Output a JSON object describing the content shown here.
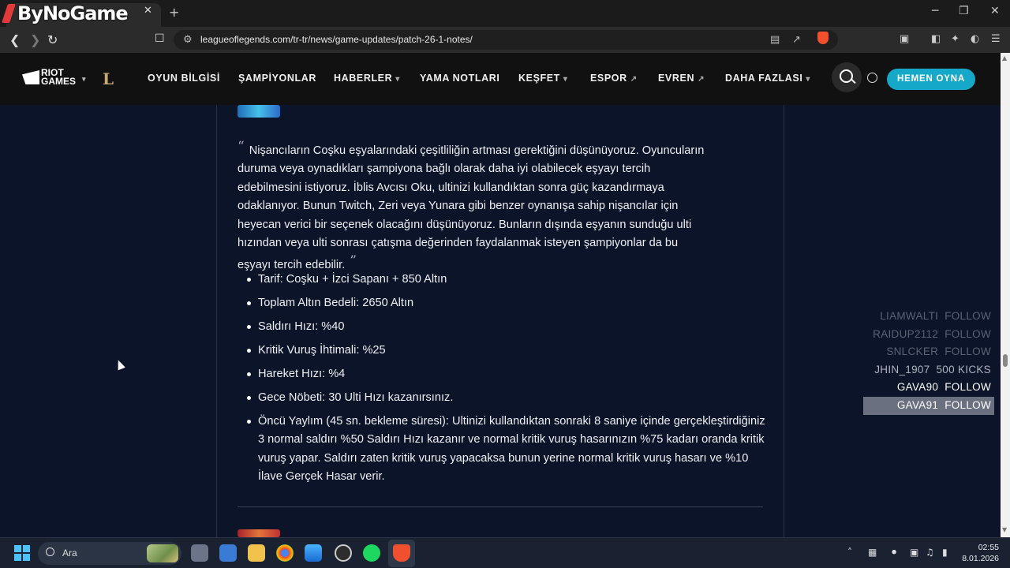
{
  "browser": {
    "tab_overlay_brand": "ByNoGame",
    "tab_close": "✕",
    "new_tab": "+",
    "url": "leagueoflegends.com/tr-tr/news/game-updates/patch-26-1-notes/",
    "window_controls": [
      "─",
      "❐",
      "✕"
    ]
  },
  "site_nav": {
    "riot_logo": "RIOT GAMES",
    "lol_logo": "L",
    "items": [
      {
        "label": "OYUN BİLGİSİ",
        "suffix": ""
      },
      {
        "label": "ŞAMPİYONLAR",
        "suffix": ""
      },
      {
        "label": "HABERLER",
        "suffix": "▾"
      },
      {
        "label": "YAMA NOTLARI",
        "suffix": ""
      },
      {
        "label": "KEŞFET",
        "suffix": "▾"
      },
      {
        "label": "ESPOR",
        "suffix": "↗"
      },
      {
        "label": "EVREN",
        "suffix": "↗"
      },
      {
        "label": "DAHA FAZLASI",
        "suffix": "▾"
      }
    ],
    "play_button": "HEMEN OYNA"
  },
  "article": {
    "quote_open": "“",
    "quote": "Nişancıların Coşku eşyalarındaki çeşitliliğin artması gerektiğini düşünüyoruz. Oyuncuların duruma veya oynadıkları şampiyona bağlı olarak daha iyi olabilecek eşyayı tercih edebilmesini istiyoruz. İblis Avcısı Oku, ultinizi kullandıktan sonra güç kazandırmaya odaklanıyor. Bunun Twitch, Zeri veya Yunara gibi benzer oynanışa sahip nişancılar için heyecan verici bir seçenek olacağını düşünüyoruz. Bunların dışında eşyanın sunduğu ulti hızından veya ulti sonrası çatışma değerinden faydalanmak isteyen şampiyonlar da bu eşyayı tercih edebilir.",
    "quote_close": "”",
    "bullets": [
      "Tarif: Coşku + İzci Sapanı + 850 Altın",
      "Toplam Altın Bedeli: 2650 Altın",
      "Saldırı Hızı: %40",
      "Kritik Vuruş İhtimali: %25",
      "Hareket Hızı: %4",
      "Gece Nöbeti: 30 Ulti Hızı kazanırsınız.",
      "Öncü Yaylım (45 sn. bekleme süresi): Ultinizi kullandıktan sonraki 8 saniye içinde gerçekleştirdiğiniz 3 normal saldırı %50 Saldırı Hızı kazanır ve normal kritik vuruş hasarınızın %75 kadarı oranda kritik vuruş yapar. Saldırı zaten kritik vuruş yapacaksa bunun yerine normal kritik vuruş hasarı ve %10 İlave Gerçek Hasar verir."
    ]
  },
  "chat_overlay": [
    {
      "user": "LIAMWALTI",
      "action": "FOLLOW",
      "style": "dim"
    },
    {
      "user": "RAIDUP2112",
      "action": "FOLLOW",
      "style": "dim"
    },
    {
      "user": "SNLCKER",
      "action": "FOLLOW",
      "style": "dim"
    },
    {
      "user": "JHIN_1907",
      "action": "500 KICKS",
      "style": "mid"
    },
    {
      "user": "GAVA90",
      "action": "FOLLOW",
      "style": "bright"
    },
    {
      "user": "GAVA91",
      "action": "FOLLOW",
      "style": "hl"
    }
  ],
  "taskbar": {
    "search_placeholder": "Ara",
    "time": "02:55",
    "date": "8.01.2026"
  }
}
